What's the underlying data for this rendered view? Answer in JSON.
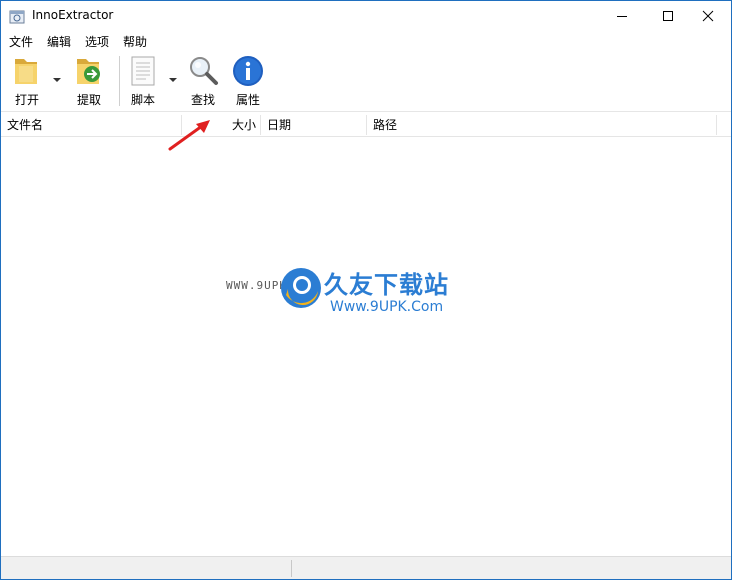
{
  "window": {
    "title": "InnoExtractor"
  },
  "menu": {
    "items": [
      "文件",
      "编辑",
      "选项",
      "帮助"
    ]
  },
  "toolbar": {
    "open_label": "打开",
    "extract_label": "提取",
    "script_label": "脚本",
    "find_label": "查找",
    "properties_label": "属性"
  },
  "list": {
    "columns": [
      "文件名",
      "大小",
      "日期",
      "路径"
    ],
    "rows": []
  },
  "watermark": {
    "small": "WWW.9UPK.COM",
    "name": "久友下载站",
    "url": "Www.9UPK.Com"
  },
  "colors": {
    "accent": "#1f6fbf",
    "watermark": "#2b7dd3",
    "arrow": "#e02020"
  },
  "icons": [
    "app-icon",
    "minimize-icon",
    "maximize-icon",
    "close-icon",
    "folder-open-icon",
    "folder-extract-icon",
    "script-document-icon",
    "magnifier-icon",
    "info-icon",
    "dropdown-arrow-icon"
  ]
}
